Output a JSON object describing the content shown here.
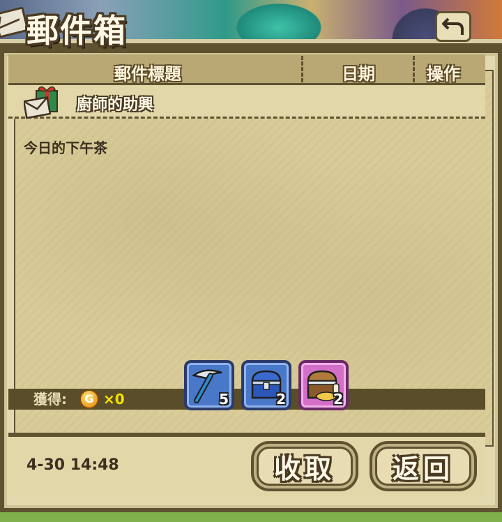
{
  "window": {
    "title": "郵件箱"
  },
  "table": {
    "headers": [
      "郵件標題",
      "日期",
      "操作"
    ]
  },
  "mail": {
    "title": "廚師的助興",
    "body": "今日的下午茶",
    "timestamp": "4-30 14:48"
  },
  "rewards": {
    "label": "獲得:",
    "coin_symbol": "G",
    "coin_count": "×0",
    "items": [
      {
        "icon": "pickaxe-icon",
        "count": "5",
        "rarity": "blue"
      },
      {
        "icon": "blue-chest-icon",
        "count": "2",
        "rarity": "blue"
      },
      {
        "icon": "treasure-chest-icon",
        "count": "2",
        "rarity": "purple"
      }
    ]
  },
  "buttons": {
    "collect": "收取",
    "back": "返回"
  },
  "colors": {
    "frame": "#5e5230",
    "panel": "#d9cc99",
    "coin_text": "#f4e300",
    "rarity_blue": "#4a78c8",
    "rarity_purple": "#d46fc8"
  }
}
